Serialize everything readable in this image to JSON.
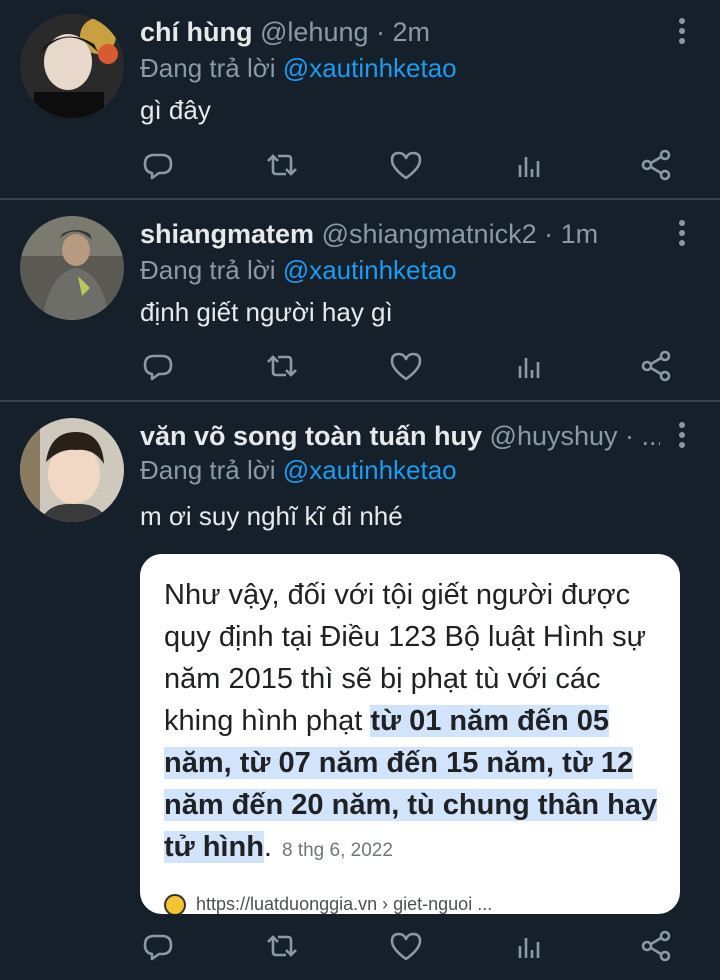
{
  "colors": {
    "background": "#15202b",
    "divider": "#38444d",
    "mention": "#1d9bf0",
    "muted": "#8b98a5",
    "highlight": "#d2e3fc"
  },
  "tweets": [
    {
      "name": "chí hùng",
      "handle": "@lehung",
      "time": "· 2m",
      "reply_prefix": "Đang trả lời",
      "reply_to": "@xautinhketao",
      "text": "gì đây"
    },
    {
      "name": "shiangmatem",
      "handle": "@shiangmatnick2",
      "time": "· 1m",
      "reply_prefix": "Đang trả lời",
      "reply_to": "@xautinhketao",
      "text": "định giết người hay gì"
    },
    {
      "name": "văn võ song toàn tuấn huy",
      "handle": "@huyshuy",
      "time": "· ...",
      "reply_prefix": "Đang trả lời",
      "reply_to": "@xautinhketao",
      "text": "m ơi suy nghĩ kĩ đi nhé",
      "card": {
        "plain_text": "Như vậy, đối với tội giết người được quy định tại Điều 123 Bộ luật Hình sự năm 2015 thì sẽ bị phạt tù với các khing hình phạt ",
        "highlighted_text": "từ 01 năm đến 05 năm, từ 07 năm đến 15 năm, từ 12 năm đến 20 năm, tù chung thân hay tử hình",
        "trailing": ".",
        "date": "8 thg 6, 2022",
        "link": "https://luatduonggia.vn › giet-nguoi ..."
      }
    }
  ],
  "action_icons": [
    "reply-icon",
    "retweet-icon",
    "like-icon",
    "analytics-icon",
    "share-icon"
  ]
}
